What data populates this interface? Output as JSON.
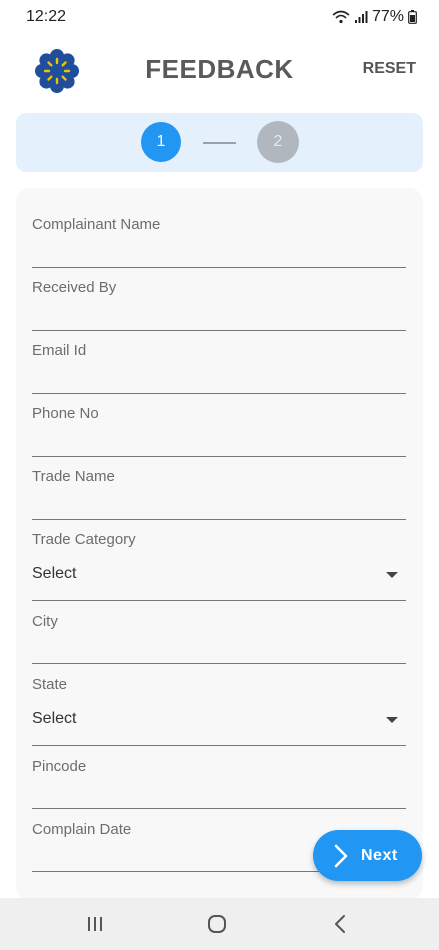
{
  "status": {
    "time": "12:22",
    "battery": "77%",
    "icons": [
      "wifi-icon",
      "signal-icon",
      "battery-icon"
    ]
  },
  "header": {
    "title": "FEEDBACK",
    "reset_label": "RESET",
    "logo": "flower-logo-icon"
  },
  "stepper": {
    "step1": "1",
    "step2": "2",
    "active_color": "#2196f3",
    "inactive_color": "#b0b7be"
  },
  "form": {
    "complainant_name": {
      "label": "Complainant Name",
      "value": ""
    },
    "received_by": {
      "label": "Received By",
      "value": ""
    },
    "email_id": {
      "label": "Email Id",
      "value": ""
    },
    "phone_no": {
      "label": "Phone No",
      "value": ""
    },
    "trade_name": {
      "label": "Trade Name",
      "value": ""
    },
    "trade_category": {
      "label": "Trade Category",
      "value": "Select"
    },
    "city": {
      "label": "City",
      "value": ""
    },
    "state": {
      "label": "State",
      "value": "Select"
    },
    "pincode": {
      "label": "Pincode",
      "value": ""
    },
    "complain_date": {
      "label": "Complain Date",
      "value": ""
    }
  },
  "next_button": {
    "label": "Next",
    "icon": "chevron-right-icon"
  },
  "nav": {
    "icons": [
      "recent-apps-icon",
      "home-icon",
      "back-icon"
    ]
  },
  "colors": {
    "accent": "#2196f3",
    "stepper_bg": "#e4f1fd",
    "card_bg": "#f8f8f8",
    "logo_blue": "#1f4f9a",
    "logo_yellow": "#f2c200"
  }
}
